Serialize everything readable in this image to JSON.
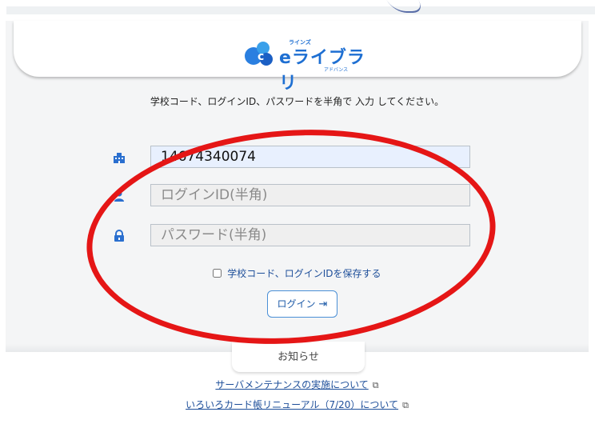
{
  "logo": {
    "small_text": "ラインズ",
    "main_text": "eライブラリ",
    "sub_text": "アドバンス"
  },
  "instruction": "学校コード、ログインID、パスワードを半角で 入力 してください。",
  "form": {
    "school_code": {
      "value": "14674340074",
      "icon": "building-icon"
    },
    "login_id": {
      "placeholder": "ログインID(半角)",
      "value": "",
      "icon": "user-icon"
    },
    "password": {
      "placeholder": "パスワード(半角)",
      "value": "",
      "icon": "lock-icon"
    },
    "remember_label": "学校コード、ログインIDを保存する",
    "remember_checked": false,
    "login_label": "ログイン",
    "login_icon": "login-arrow-icon"
  },
  "notices": {
    "tab_label": "お知らせ",
    "links": [
      {
        "label": "サーバメンテナンスの実施について",
        "icon": "external-link-icon"
      },
      {
        "label": "いろいろカード帳リニューアル（7/20）について",
        "icon": "external-link-icon"
      }
    ]
  },
  "colors": {
    "accent": "#1e6fd2",
    "annotation": "#e51616",
    "field_filled_bg": "#e8f0fe"
  }
}
